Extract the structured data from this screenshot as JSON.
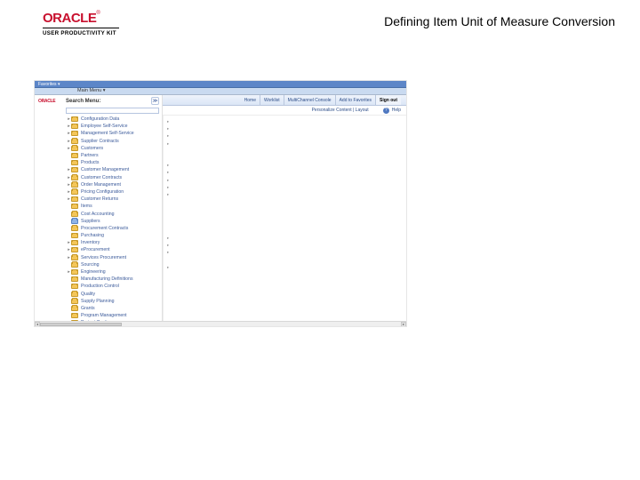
{
  "doc": {
    "logo_word": "ORACLE",
    "logo_sub": "USER PRODUCTIVITY KIT",
    "title": "Defining Item Unit of Measure Conversion"
  },
  "app": {
    "favorites_label": "Favorites ▾",
    "main_menu_label": "Main Menu ▾",
    "brand_stub": "ORACLE"
  },
  "sidebar": {
    "search_label": "Search Menu:",
    "go_glyph": "≫",
    "items": [
      {
        "label": "Configuration Data",
        "exp": "▸"
      },
      {
        "label": "Employee Self-Service",
        "exp": "▸"
      },
      {
        "label": "Management Self-Service",
        "exp": "▸"
      },
      {
        "label": "Supplier Contracts",
        "exp": "▸"
      },
      {
        "label": "Customers",
        "exp": "▸"
      },
      {
        "label": "Partners",
        "exp": ""
      },
      {
        "label": "Products",
        "exp": ""
      },
      {
        "label": "Customer Management",
        "exp": "▸"
      },
      {
        "label": "Customer Contracts",
        "exp": "▸"
      },
      {
        "label": "Order Management",
        "exp": "▸"
      },
      {
        "label": "Pricing Configuration",
        "exp": "▸"
      },
      {
        "label": "Customer Returns",
        "exp": "▸"
      },
      {
        "label": "Items",
        "exp": ""
      },
      {
        "label": "Cost Accounting",
        "exp": ""
      },
      {
        "label": "Suppliers",
        "exp": "",
        "blue": true
      },
      {
        "label": "Procurement Contracts",
        "exp": ""
      },
      {
        "label": "Purchasing",
        "exp": ""
      },
      {
        "label": "Inventory",
        "exp": "▸"
      },
      {
        "label": "eProcurement",
        "exp": "▸"
      },
      {
        "label": "Services Procurement",
        "exp": "▸"
      },
      {
        "label": "Sourcing",
        "exp": ""
      },
      {
        "label": "Engineering",
        "exp": "▸"
      },
      {
        "label": "Manufacturing Definitions",
        "exp": ""
      },
      {
        "label": "Production Control",
        "exp": ""
      },
      {
        "label": "Quality",
        "exp": ""
      },
      {
        "label": "Supply Planning",
        "exp": ""
      },
      {
        "label": "Grants",
        "exp": ""
      },
      {
        "label": "Program Management",
        "exp": ""
      },
      {
        "label": "Project Costing",
        "exp": ""
      }
    ]
  },
  "toolbar": {
    "items": [
      "Home",
      "Worklist",
      "MultiChannel Console",
      "Add to Favorites"
    ],
    "sign_out": "Sign out"
  },
  "sub_toolbar": {
    "label": "Personalize Content | Layout",
    "help": "Help",
    "help_glyph": "?"
  },
  "hints": [
    "▸",
    "▸",
    "▸",
    "▸",
    "",
    "",
    "▸",
    "▸",
    "▸",
    "▸",
    "▸",
    "",
    "",
    "",
    "",
    "",
    "▸",
    "▸",
    "▸",
    "",
    "▸",
    "",
    "",
    "",
    "",
    "",
    "",
    ""
  ]
}
